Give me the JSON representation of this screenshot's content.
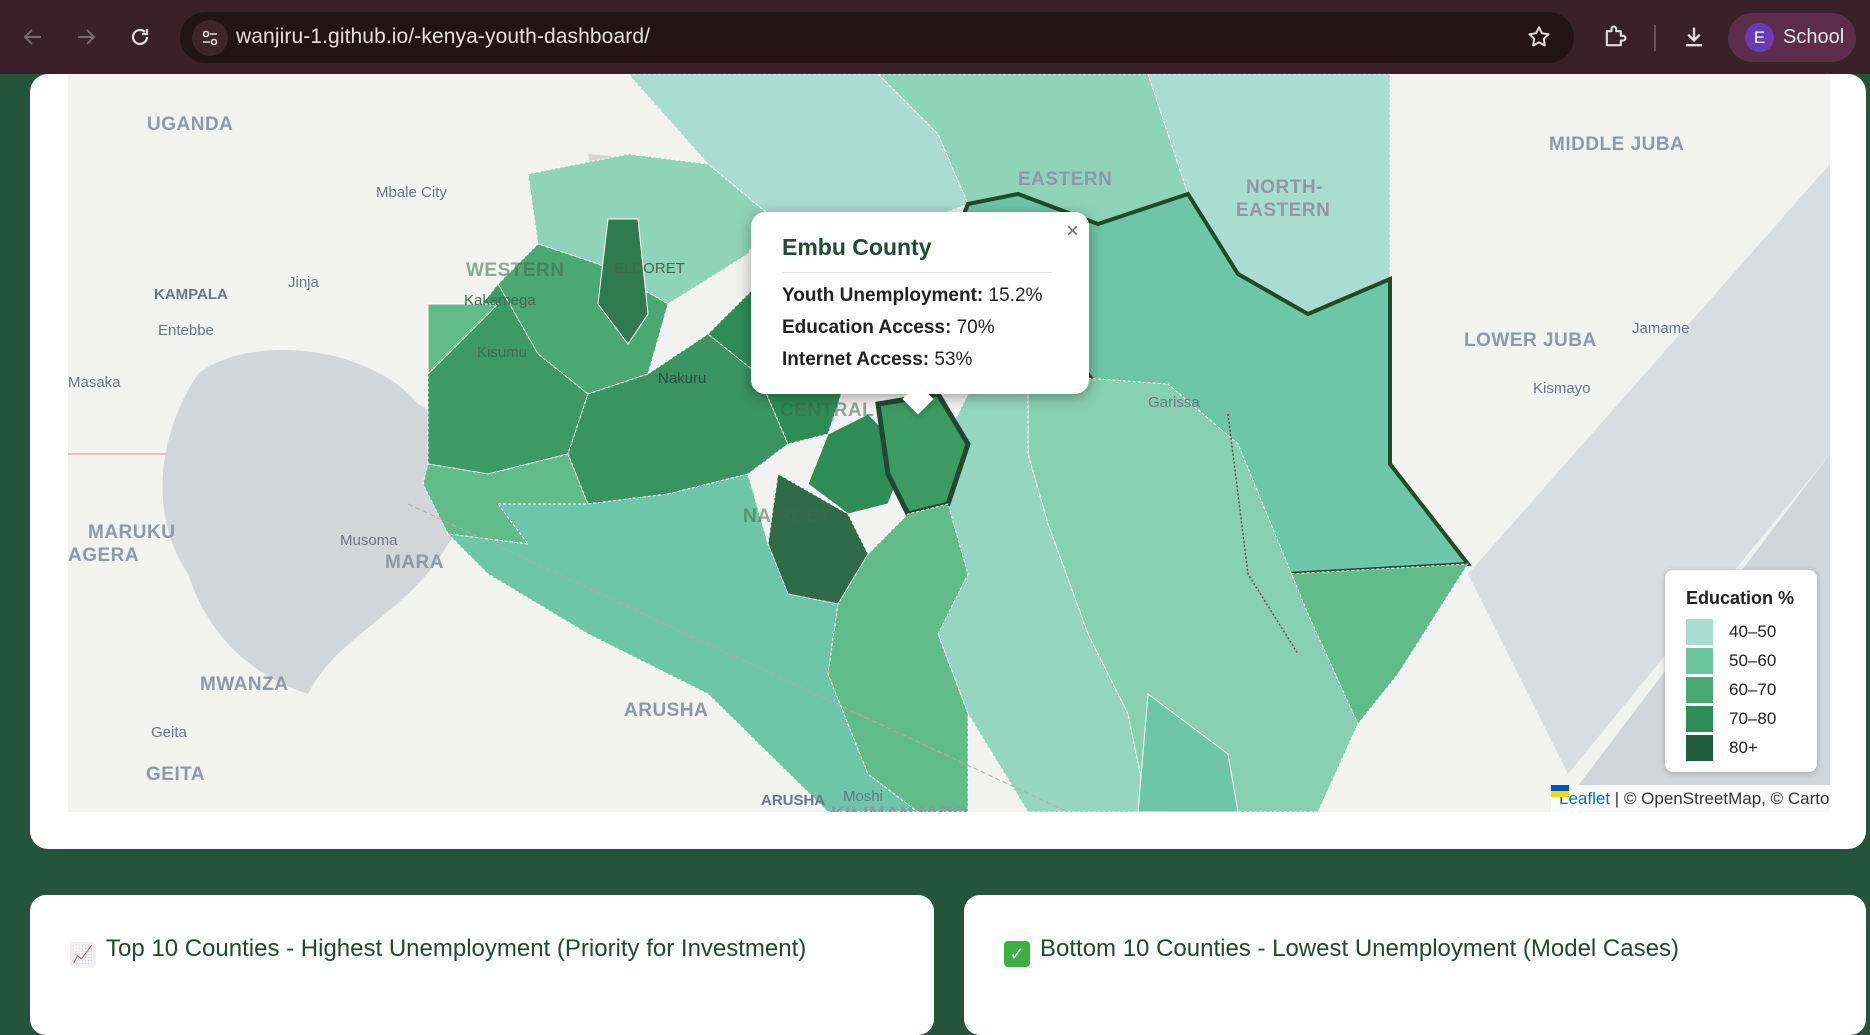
{
  "browser": {
    "url": "wanjiru-1.github.io/-kenya-youth-dashboard/",
    "profile_initial": "E",
    "profile_name": "School"
  },
  "map": {
    "region_labels": {
      "uganda": "UGANDA",
      "middle_juba": "MIDDLE JUBA",
      "eastern": "EASTERN",
      "north_eastern_1": "NORTH-",
      "north_eastern_2": "EASTERN",
      "western": "WESTERN",
      "lower_juba": "LOWER JUBA",
      "central": "CENTRAL",
      "nairobi": "NAIROBI",
      "maruku": "MARUKU",
      "agera": "AGERA",
      "mara": "MARA",
      "mwanza": "MWANZA",
      "arusha": "ARUSHA",
      "geita": "GEITA",
      "kilimanjaro": "KILIMANJARO"
    },
    "city_labels": {
      "mbale": "Mbale City",
      "jinja": "Jinja",
      "kampala": "KAMPALA",
      "entebbe": "Entebbe",
      "masaka": "Masaka",
      "eldoret": "ELDORET",
      "kakamega": "Kakamega",
      "kisumu": "Kisumu",
      "nakuru": "Nakuru",
      "garissa": "Garissa",
      "jamame": "Jamame",
      "kismayo": "Kismayo",
      "musoma": "Musoma",
      "geita_town": "Geita",
      "arusha_town": "ARUSHA",
      "moshi": "Moshi"
    },
    "popup": {
      "title": "Embu County",
      "close_symbol": "×",
      "youth_unemployment_label": "Youth Unemployment:",
      "youth_unemployment_value": "15.2%",
      "education_access_label": "Education Access:",
      "education_access_value": "70%",
      "internet_access_label": "Internet Access:",
      "internet_access_value": "53%"
    },
    "legend": {
      "title": "Education %",
      "items": [
        {
          "label": "40–50",
          "color": "#a8ddd0"
        },
        {
          "label": "50–60",
          "color": "#6bc49a"
        },
        {
          "label": "60–70",
          "color": "#4aa872"
        },
        {
          "label": "70–80",
          "color": "#2e8c57"
        },
        {
          "label": "80+",
          "color": "#1f5e3c"
        }
      ]
    },
    "attribution": {
      "leaflet": "Leaflet",
      "rest": "| © OpenStreetMap, © CartoDB"
    }
  },
  "cards": {
    "top10_icon": "📈",
    "top10_title": "Top 10 Counties - Highest Unemployment (Priority for Investment)",
    "bottom10_icon": "✓",
    "bottom10_title": "Bottom 10 Counties - Lowest Unemployment (Model Cases)"
  },
  "colors": {
    "page_background": "#24553a",
    "accent_dark_green": "#1f4a30"
  }
}
